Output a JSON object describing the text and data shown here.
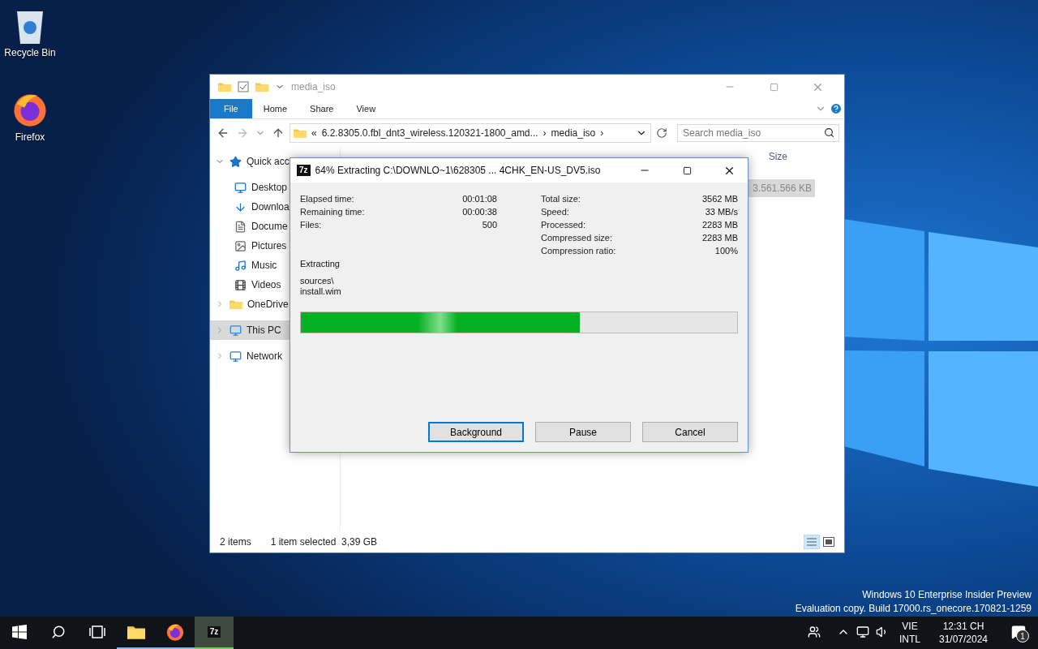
{
  "desktop_icons": [
    {
      "kind": "recycle",
      "label": "Recycle Bin"
    },
    {
      "kind": "firefox",
      "label": "Firefox"
    }
  ],
  "explorer": {
    "title": "media_iso",
    "ribbon_tabs": [
      {
        "kind": "file",
        "label": "File"
      },
      {
        "kind": "tab",
        "label": "Home"
      },
      {
        "kind": "tab",
        "label": "Share"
      },
      {
        "kind": "tab",
        "label": "View"
      }
    ],
    "address": {
      "overflow": "«",
      "path": "6.2.8305.0.fbl_dnt3_wireless.120321-1800_amd...",
      "current": "media_iso",
      "separator": "›"
    },
    "search": {
      "placeholder": "Search media_iso"
    },
    "columns": [
      "Size"
    ],
    "nav": [
      {
        "kind": "star",
        "label": "Quick acc",
        "expanded": true,
        "selected": false,
        "children": [
          {
            "kind": "desktop",
            "label": "Desktop"
          },
          {
            "kind": "download",
            "label": "Downloa"
          },
          {
            "kind": "document",
            "label": "Docume"
          },
          {
            "kind": "pictures",
            "label": "Pictures"
          },
          {
            "kind": "music",
            "label": "Music"
          },
          {
            "kind": "videos",
            "label": "Videos"
          }
        ]
      },
      {
        "kind": "onedrive",
        "label": "OneDrive",
        "expanded": false,
        "selected": false
      },
      {
        "kind": "pc",
        "label": "This PC",
        "expanded": false,
        "selected": true
      },
      {
        "kind": "network",
        "label": "Network",
        "expanded": false,
        "selected": false
      }
    ],
    "visible_cell": {
      "text": "3.561.566 KB",
      "selected": true
    },
    "status": {
      "items": "2 items",
      "selection": "1 item selected  3,39 GB"
    }
  },
  "dialog": {
    "icon_text": "7z",
    "title": "64% Extracting C:\\DOWNLO~1\\628305 ... 4CHK_EN-US_DV5.iso",
    "left_stats": [
      {
        "label": "Elapsed time:",
        "value": "00:01:08"
      },
      {
        "label": "Remaining time:",
        "value": "00:00:38"
      },
      {
        "label": "Files:",
        "value": "500"
      }
    ],
    "right_stats": [
      {
        "label": "Total size:",
        "value": "3562 MB"
      },
      {
        "label": "Speed:",
        "value": "33 MB/s"
      },
      {
        "label": "Processed:",
        "value": "2283 MB"
      },
      {
        "label": "Compressed size:",
        "value": "2283 MB"
      },
      {
        "label": "Compression ratio:",
        "value": "100%"
      }
    ],
    "operation": "Extracting",
    "folder": "sources\\",
    "file": "install.wim",
    "progress": {
      "level": 0.64
    },
    "buttons": [
      {
        "label": "Background",
        "focused": true
      },
      {
        "label": "Pause",
        "focused": false
      },
      {
        "label": "Cancel",
        "focused": false
      }
    ]
  },
  "watermark_lines": [
    "Windows 10 Enterprise Insider Preview",
    "Evaluation copy. Build 17000.rs_onecore.170821-1259"
  ],
  "taskbar": {
    "apps": [
      {
        "kind": "explorer",
        "active": false
      },
      {
        "kind": "firefox",
        "active": false
      },
      {
        "kind": "sevenzip",
        "active": true,
        "label": "7z"
      }
    ],
    "language": [
      "VIE",
      "INTL"
    ],
    "time": "12:31 CH",
    "date": "31/07/2024",
    "notifications": "1"
  }
}
